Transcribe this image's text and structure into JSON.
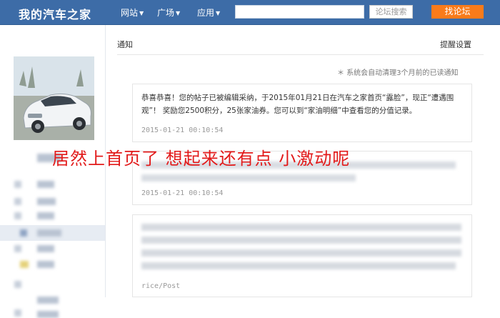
{
  "header": {
    "logo": "我的汽车之家",
    "nav": [
      {
        "label": "网站"
      },
      {
        "label": "广场"
      },
      {
        "label": "应用"
      }
    ],
    "search_button": "论坛搜索",
    "find_button": "找论坛"
  },
  "main": {
    "tab": "通知",
    "settings_link": "提醒设置",
    "tip": "＊ 系统会自动清理3个月前的已读通知",
    "cards": [
      {
        "text": "恭喜恭喜！您的帖子已被编辑采纳，于2015年01月21日在汽车之家首页“露脸”，现正“遭遇围观”！ 奖励您2500积分，25张家油券。您可以到“家油明细”中查看您的分值记录。",
        "time": "2015-01-21 00:10:54"
      },
      {
        "text": "",
        "time": "2015-01-21 00:10:54"
      },
      {
        "text": "",
        "tail": "rice/Post"
      }
    ]
  },
  "overlay_caption": "居然上首页了  想起来还有点  小激动呢",
  "colors": {
    "header_bg": "#3d6ca7",
    "find_button": "#f97b1a",
    "overlay_text": "#e21a1a"
  }
}
